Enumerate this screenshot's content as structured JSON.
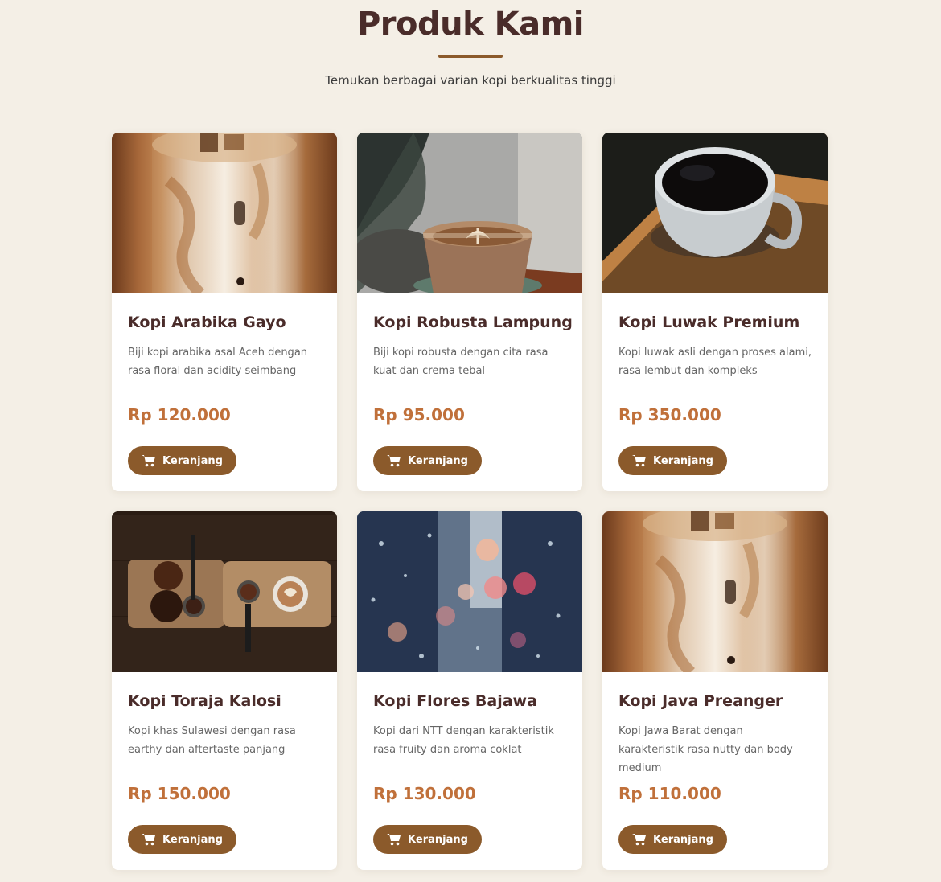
{
  "header": {
    "title": "Produk Kami",
    "subtitle": "Temukan berbagai varian kopi berkualitas tinggi"
  },
  "products": [
    {
      "name": "Kopi Arabika Gayo",
      "description": "Biji kopi arabika asal Aceh dengan rasa floral dan acidity seimbang",
      "price": "Rp 120.000",
      "button_label": "Keranjang",
      "image": "iced-coffee-glass"
    },
    {
      "name": "Kopi Robusta Lampung",
      "description": "Biji kopi robusta dengan cita rasa kuat dan crema tebal",
      "price": "Rp 95.000",
      "button_label": "Keranjang",
      "image": "latte-art-glass"
    },
    {
      "name": "Kopi Luwak Premium",
      "description": "Kopi luwak asli dengan proses alami, rasa lembut dan kompleks",
      "price": "Rp 350.000",
      "button_label": "Keranjang",
      "image": "black-coffee-cup"
    },
    {
      "name": "Kopi Toraja Kalosi",
      "description": "Kopi khas Sulawesi dengan rasa earthy dan aftertaste panjang",
      "price": "Rp 150.000",
      "button_label": "Keranjang",
      "image": "coffee-tools-board"
    },
    {
      "name": "Kopi Flores Bajawa",
      "description": "Kopi dari NTT dengan karakteristik rasa fruity dan aroma coklat",
      "price": "Rp 130.000",
      "button_label": "Keranjang",
      "image": "rainy-window-bokeh"
    },
    {
      "name": "Kopi Java Preanger",
      "description": "Kopi Jawa Barat dengan karakteristik rasa nutty dan body medium",
      "price": "Rp 110.000",
      "button_label": "Keranjang",
      "image": "iced-coffee-glass"
    }
  ],
  "icons": {
    "cart": "cart-icon"
  },
  "colors": {
    "background": "#f4efe6",
    "title": "#4a2c2a",
    "price": "#c0703a",
    "button": "#8b5a2b"
  }
}
